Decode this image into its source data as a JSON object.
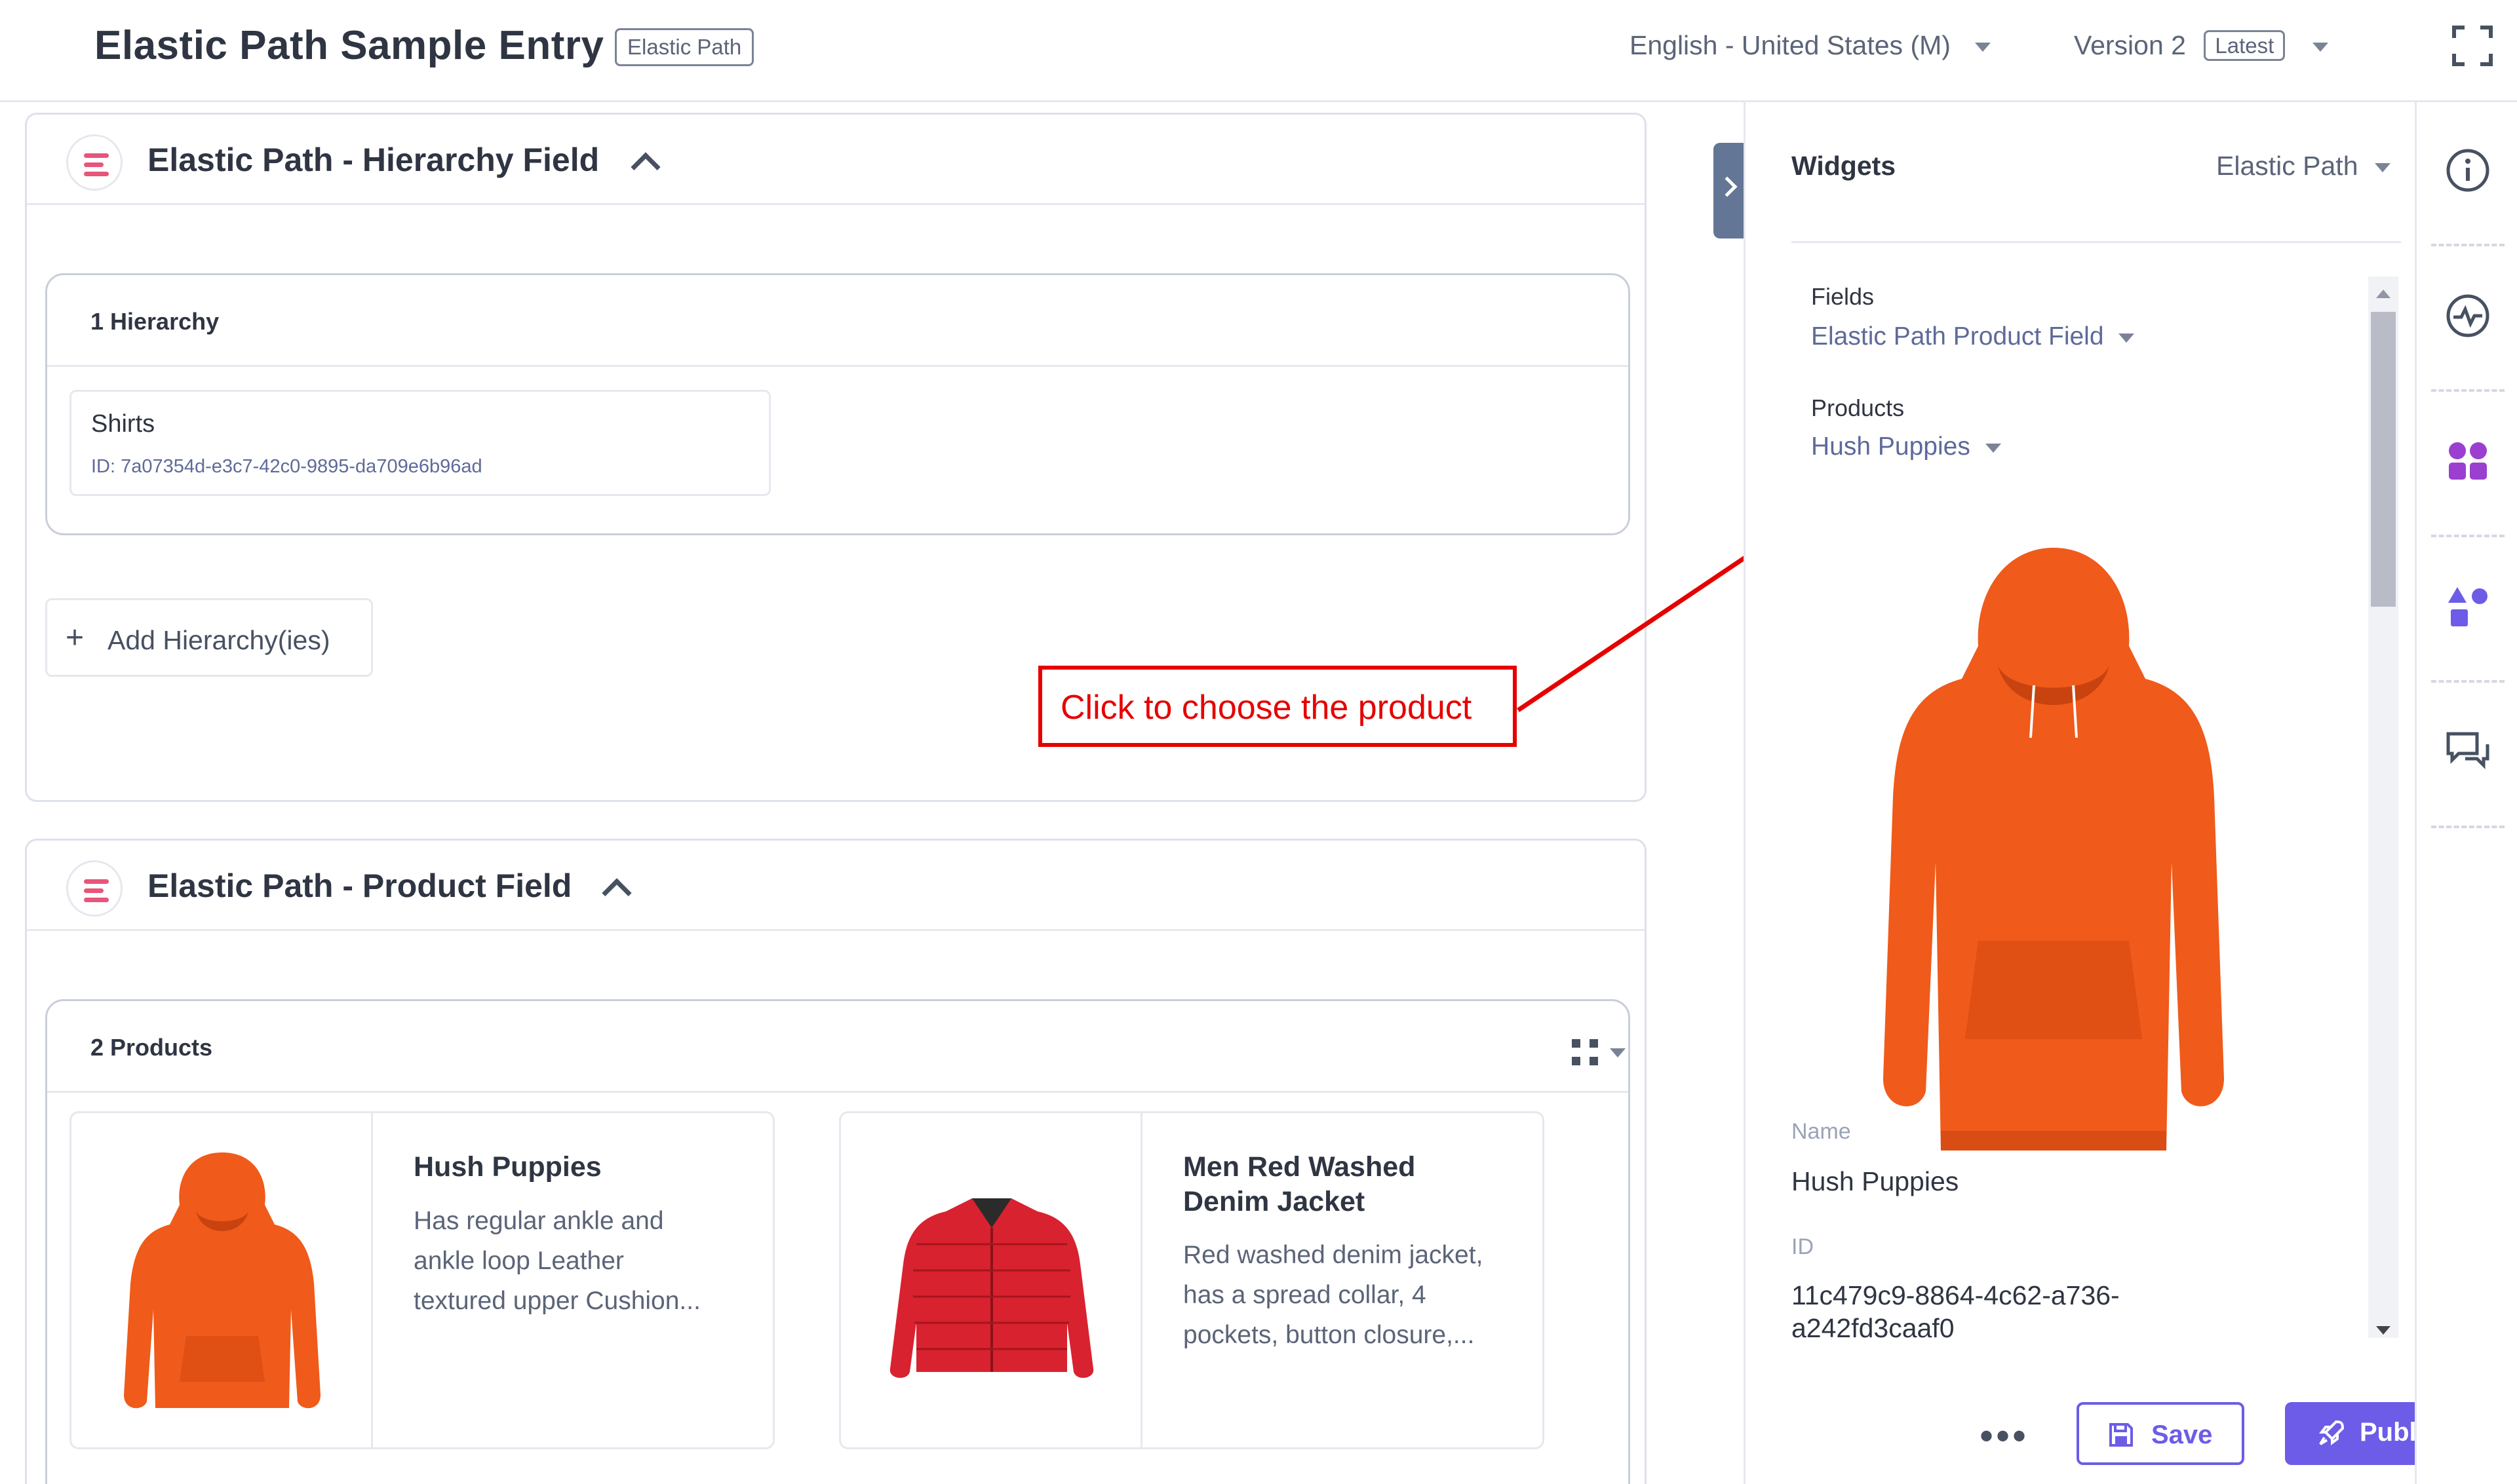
{
  "header": {
    "title": "Elastic Path Sample Entry",
    "title_tag": "Elastic Path",
    "locale": "English - United States (M)",
    "version": "Version 2",
    "version_tag": "Latest"
  },
  "hierarchy_field": {
    "title": "Elastic Path - Hierarchy Field",
    "count_label": "1 Hierarchy",
    "items": [
      {
        "name": "Shirts",
        "id": "ID: 7a07354d-e3c7-42c0-9895-da709e6b96ad"
      }
    ],
    "add_button": "Add Hierarchy(ies)"
  },
  "annotation": {
    "text": "Click to choose the product"
  },
  "product_field": {
    "title": "Elastic Path - Product Field",
    "count_label": "2 Products",
    "products": [
      {
        "name": "Hush Puppies",
        "description": [
          "Has regular ankle and",
          "ankle loop Leather",
          "textured upper Cushion..."
        ],
        "image": "orange-hoodie"
      },
      {
        "name_lines": [
          "Men Red Washed",
          "Denim Jacket"
        ],
        "description": [
          "Red washed denim jacket,",
          "has a spread collar, 4",
          "pockets, button closure,..."
        ],
        "image": "red-puffer-jacket"
      }
    ]
  },
  "widgets_panel": {
    "title": "Widgets",
    "selector": "Elastic Path",
    "fields_label": "Fields",
    "fields_value": "Elastic Path Product Field",
    "products_label": "Products",
    "products_value": "Hush Puppies",
    "name_label": "Name",
    "name_value": "Hush Puppies",
    "id_label": "ID",
    "id_value_lines": [
      "11c479c9-8864-4c62-a736-",
      "a242fd3caaf0"
    ]
  },
  "footer": {
    "more": "•••",
    "save": "Save",
    "publish": "Publish"
  },
  "rail": {
    "icons": [
      "info-icon",
      "activity-icon",
      "extensions-icon",
      "shapes-icon",
      "comments-icon"
    ]
  },
  "colors": {
    "accent": "#6c5ce7",
    "annotation_red": "#e60000",
    "field_icon": "#e8557a",
    "link_text": "#5e6a9a",
    "hoodie_orange": "#f05a1a",
    "jacket_red": "#d9222f"
  }
}
